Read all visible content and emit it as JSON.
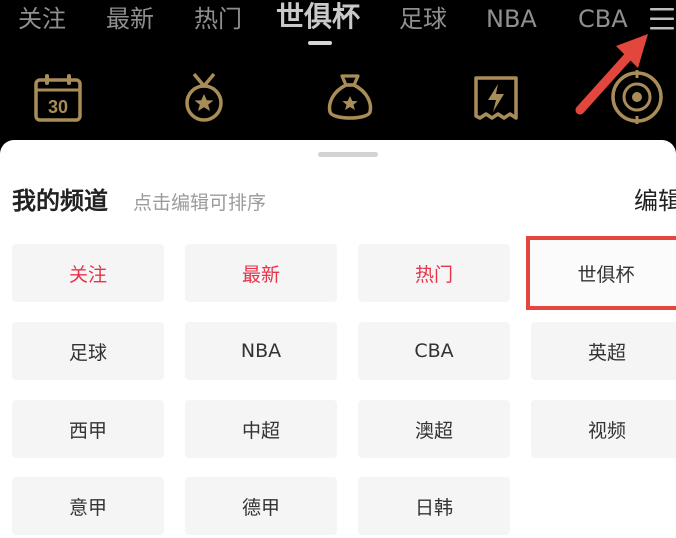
{
  "tabs": [
    {
      "label": "关注"
    },
    {
      "label": "最新"
    },
    {
      "label": "热门"
    },
    {
      "label": "世俱杯"
    },
    {
      "label": "足球"
    },
    {
      "label": "NBA"
    },
    {
      "label": "CBA"
    }
  ],
  "active_tab": "世俱杯",
  "feature_icons": [
    "calendar-30-icon",
    "medal-icon",
    "money-bag-icon",
    "lottery-ticket-icon",
    "roulette-icon"
  ],
  "feature_icon_badge": "30",
  "colors": {
    "header_bg": "#000000",
    "icon_gold": "#a98d58",
    "fixed_channel_red": "#e8344b",
    "annotation_red": "#e2463c",
    "chip_bg": "#f5f5f5"
  },
  "channel_sheet": {
    "title": "我的频道",
    "hint": "点击编辑可排序",
    "edit_label": "编辑",
    "channels": [
      {
        "label": "关注",
        "fixed": true
      },
      {
        "label": "最新",
        "fixed": true
      },
      {
        "label": "热门",
        "fixed": true
      },
      {
        "label": "世俱杯",
        "fixed": false,
        "highlighted": true
      },
      {
        "label": "足球",
        "fixed": false
      },
      {
        "label": "NBA",
        "fixed": false
      },
      {
        "label": "CBA",
        "fixed": false
      },
      {
        "label": "英超",
        "fixed": false
      },
      {
        "label": "西甲",
        "fixed": false
      },
      {
        "label": "中超",
        "fixed": false
      },
      {
        "label": "澳超",
        "fixed": false
      },
      {
        "label": "视频",
        "fixed": false
      },
      {
        "label": "意甲",
        "fixed": false
      },
      {
        "label": "德甲",
        "fixed": false
      },
      {
        "label": "日韩",
        "fixed": false
      }
    ]
  }
}
